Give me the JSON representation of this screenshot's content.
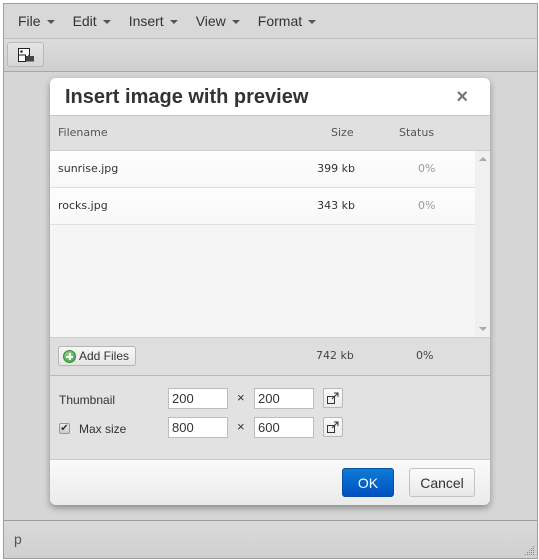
{
  "menubar": {
    "items": [
      {
        "label": "File"
      },
      {
        "label": "Edit"
      },
      {
        "label": "Insert"
      },
      {
        "label": "View"
      },
      {
        "label": "Format"
      }
    ]
  },
  "toolbar": {
    "buttons": [
      {
        "icon": "insert-image-icon"
      }
    ]
  },
  "statusbar": {
    "path": "p"
  },
  "dialog": {
    "title": "Insert image with preview",
    "close_glyph": "×",
    "columns": {
      "filename": "Filename",
      "size": "Size",
      "status": "Status"
    },
    "files": [
      {
        "name": "sunrise.jpg",
        "size": "399 kb",
        "status": "0%"
      },
      {
        "name": "rocks.jpg",
        "size": "343 kb",
        "status": "0%"
      }
    ],
    "footer": {
      "add_label": "Add Files",
      "total_size": "742 kb",
      "total_status": "0%"
    },
    "options": {
      "thumbnail_label": "Thumbnail",
      "thumbnail_width": "200",
      "thumbnail_height": "200",
      "maxsize_label": "Max size",
      "maxsize_checked": true,
      "maxsize_width": "800",
      "maxsize_height": "600",
      "times": "×"
    },
    "buttons": {
      "ok": "OK",
      "cancel": "Cancel"
    },
    "colors": {
      "primary": "#0066cc"
    }
  }
}
